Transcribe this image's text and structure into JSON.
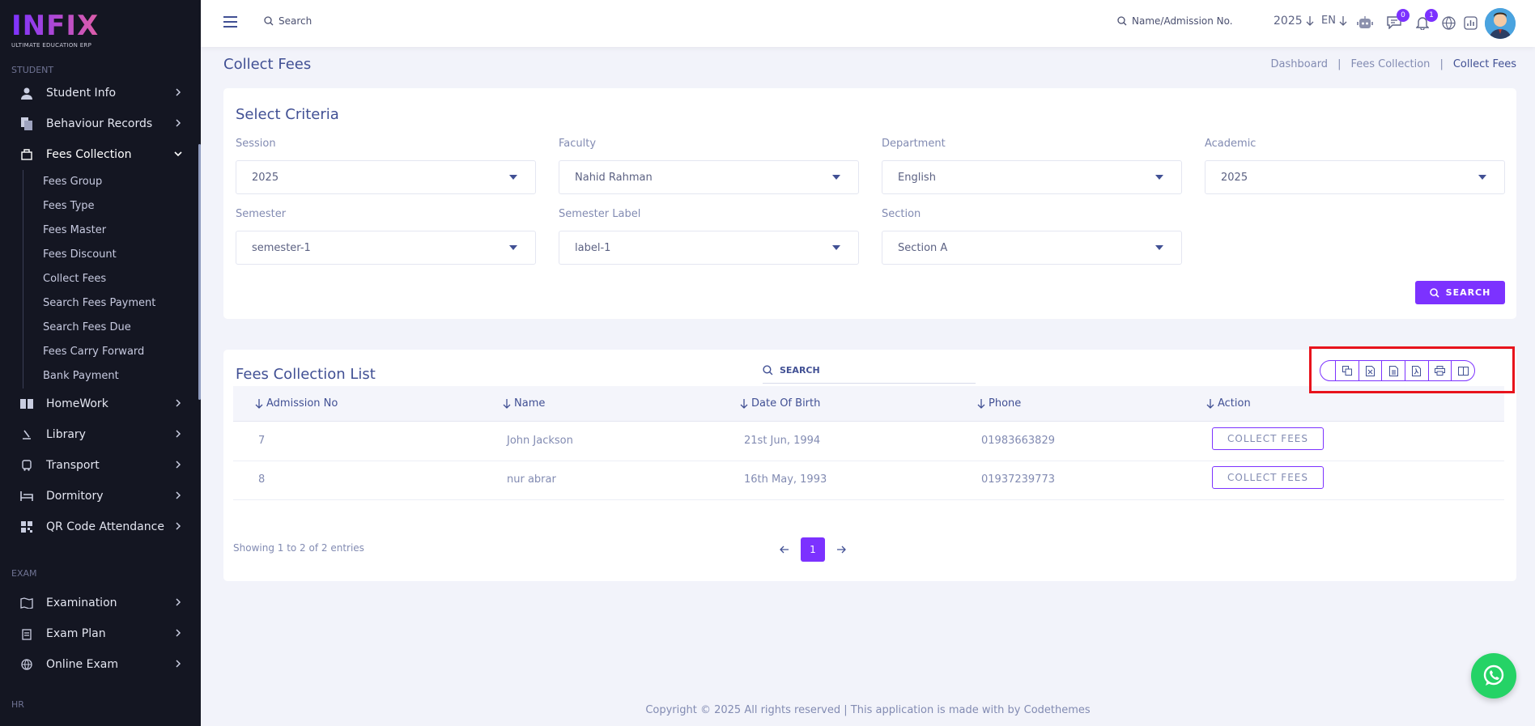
{
  "brand": {
    "logo": "INFIX",
    "tagline": "ULTIMATE EDUCATION ERP"
  },
  "sidebar": {
    "student_section": "STUDENT",
    "items": [
      {
        "label": "Student Info",
        "icon": "user-icon"
      },
      {
        "label": "Behaviour Records",
        "icon": "files-icon"
      },
      {
        "label": "Fees Collection",
        "icon": "cash-icon",
        "expanded": true
      },
      {
        "label": "HomeWork",
        "icon": "book-icon"
      },
      {
        "label": "Library",
        "icon": "library-icon"
      },
      {
        "label": "Transport",
        "icon": "bus-icon"
      },
      {
        "label": "Dormitory",
        "icon": "bed-icon"
      },
      {
        "label": "QR Code Attendance",
        "icon": "qr-icon"
      }
    ],
    "fees_sub": [
      "Fees Group",
      "Fees Type",
      "Fees Master",
      "Fees Discount",
      "Collect Fees",
      "Search Fees Payment",
      "Search Fees Due",
      "Fees Carry Forward",
      "Bank Payment"
    ],
    "exam_section": "EXAM",
    "exam_items": [
      {
        "label": "Examination",
        "icon": "map-icon"
      },
      {
        "label": "Exam Plan",
        "icon": "clipboard-icon"
      },
      {
        "label": "Online Exam",
        "icon": "globe-icon"
      }
    ],
    "hr_section": "HR"
  },
  "topbar": {
    "search_label": "Search",
    "admission_search": "Name/Admission No.",
    "year": "2025",
    "lang": "EN",
    "chat_count": "0",
    "notif_count": "1"
  },
  "page": {
    "title": "Collect Fees",
    "breadcrumb": [
      "Dashboard",
      "Fees Collection",
      "Collect Fees"
    ]
  },
  "criteria": {
    "title": "Select Criteria",
    "fields": [
      {
        "label": "Session",
        "value": "2025"
      },
      {
        "label": "Faculty",
        "value": "Nahid Rahman"
      },
      {
        "label": "Department",
        "value": "English"
      },
      {
        "label": "Academic",
        "value": "2025"
      },
      {
        "label": "Semester",
        "value": "semester-1"
      },
      {
        "label": "Semester Label",
        "value": "label-1"
      },
      {
        "label": "Section",
        "value": "Section A"
      }
    ],
    "search_button": "SEARCH"
  },
  "list": {
    "title": "Fees Collection List",
    "search_placeholder": "SEARCH",
    "columns": [
      "Admission No",
      "Name",
      "Date Of Birth",
      "Phone",
      "Action"
    ],
    "rows": [
      {
        "admission": "7",
        "name": "John Jackson",
        "dob": "21st Jun, 1994",
        "phone": "01983663829",
        "action": "COLLECT FEES"
      },
      {
        "admission": "8",
        "name": "nur abrar",
        "dob": "16th May, 1993",
        "phone": "01937239773",
        "action": "COLLECT FEES"
      }
    ],
    "showing": "Showing 1 to 2 of 2 entries",
    "current_page": "1",
    "export_icons": [
      "copy-icon",
      "excel-icon",
      "csv-icon",
      "pdf-icon",
      "print-icon",
      "columns-icon"
    ]
  },
  "footer": "Copyright © 2025 All rights reserved | This application is made with by Codethemes",
  "colors": {
    "accent": "#7c32ff",
    "sidebar_bg": "#141622",
    "highlight": "#e8131c",
    "whatsapp": "#25d366"
  }
}
